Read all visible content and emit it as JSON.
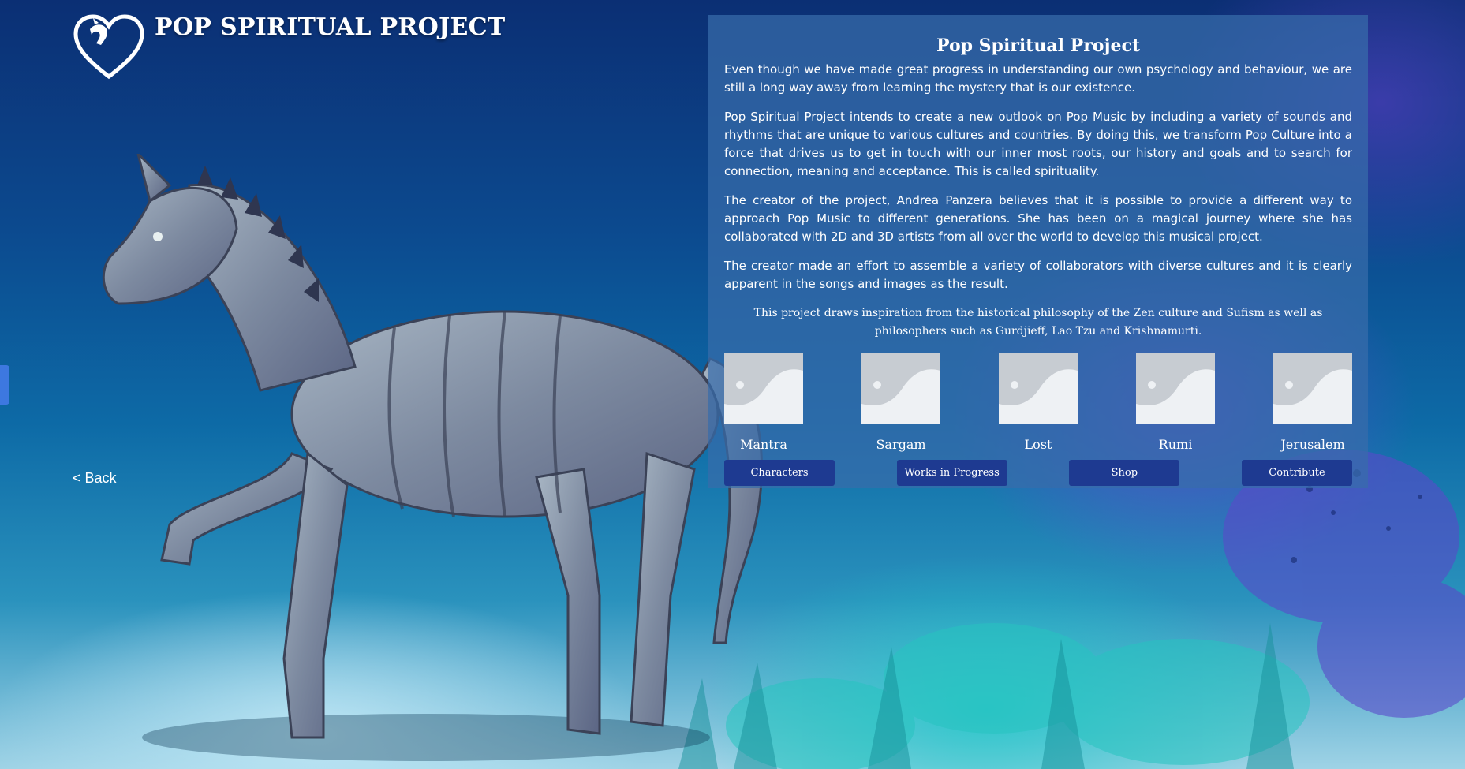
{
  "header": {
    "site_title": "POP SPIRITUAL PROJECT",
    "logo_icon": "heart-horse-logo-icon"
  },
  "navigation": {
    "back_label": "< Back"
  },
  "panel": {
    "title": "Pop Spiritual Project",
    "paragraphs": [
      "Even though we have made great progress in understanding our own psychology and behaviour, we are still a long way away from learning the mystery that is our existence.",
      "Pop Spiritual Project intends to create a new outlook on Pop Music by including a variety of sounds and rhythms that are unique to various cultures and countries. By doing this, we transform Pop Culture into a force that drives us to get in touch with our inner most roots, our history and goals and to search for connection, meaning and acceptance. This is called spirituality.",
      "The creator of the project, Andrea Panzera believes that it is possible to provide a different way to approach Pop Music to different generations. She has been on a magical journey where she has collaborated with 2D and 3D artists from all over the world to develop this musical project.",
      "The creator made an effort to assemble a variety of collaborators with diverse cultures and it is clearly apparent in the songs and images as the result."
    ],
    "quote": "This project draws inspiration from the historical philosophy of the Zen culture and Sufism as well as philosophers such as Gurdjieff, Lao Tzu and Krishnamurti.",
    "songs": [
      {
        "label": "Mantra",
        "icon": "image-placeholder-icon"
      },
      {
        "label": "Sargam",
        "icon": "image-placeholder-icon"
      },
      {
        "label": "Lost",
        "icon": "image-placeholder-icon"
      },
      {
        "label": "Rumi",
        "icon": "image-placeholder-icon"
      },
      {
        "label": "Jerusalem",
        "icon": "image-placeholder-icon"
      }
    ],
    "buttons": {
      "characters": "Characters",
      "works_in_progress": "Works in Progress",
      "shop": "Shop",
      "contribute": "Contribute"
    }
  },
  "colors": {
    "panel_background": "#376caa",
    "button_background": "#1e3a91",
    "side_tab": "#3d78e0"
  }
}
